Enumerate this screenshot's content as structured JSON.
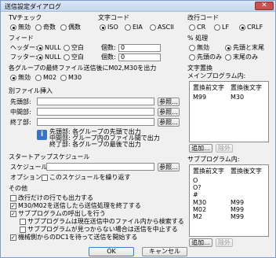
{
  "window": {
    "title": "送信設定ダイアログ",
    "close_symbol": "✕"
  },
  "tv_check": {
    "label": "TVチェック",
    "options": [
      "無効",
      "奇数",
      "偶数"
    ],
    "selected": 0
  },
  "char_code": {
    "label": "文字コード",
    "options": [
      "ISO",
      "EIA",
      "ASCII"
    ],
    "selected": 0
  },
  "newline_code": {
    "label": "改行コード",
    "options": [
      "CR",
      "LF",
      "CRLF"
    ],
    "selected": 2
  },
  "feed": {
    "label": "フィード",
    "header_label": "ヘッダー:",
    "footer_label": "フッター:",
    "options": [
      "NULL",
      "空白"
    ],
    "header_selected": 0,
    "footer_selected": 0,
    "count_label": "個数:",
    "header_count": "0",
    "footer_count": "0"
  },
  "percent_process": {
    "label": "% 処理",
    "options": [
      "無効",
      "先頭と末尾",
      "先頭のみ",
      "末尾のみ"
    ],
    "selected": 1
  },
  "group_last": {
    "label": "各グループの最終ファイル送信後にM02,M30を出力",
    "options": [
      "無効",
      "M02",
      "M30"
    ],
    "selected": 0
  },
  "file_insert": {
    "label": "別ファイル挿入",
    "head_label": "先頭部:",
    "middle_label": "中間部:",
    "end_label": "終了部:",
    "browse_label": "参照...",
    "info_lines": [
      "先頭部: 各グループの先頭で出力",
      "中間部: グループ内のファイル間で出力",
      "終了部: 各グループの最後で出力"
    ]
  },
  "startup": {
    "label": "スタートアップスケジュール",
    "schedule_label": "スケジュール:",
    "browse_label": "参照...",
    "option_label": "オプション:",
    "repeat_label": "このスケジュールを繰り返す",
    "repeat_checked": false
  },
  "others": {
    "label": "その他",
    "items": [
      {
        "text": "改行だけの行でも出力する",
        "checked": false,
        "indent": 0
      },
      {
        "text": "M30/M02を送信したら送信処理を終了する",
        "checked": true,
        "indent": 0
      },
      {
        "text": "サブプログラムの呼出しを行う",
        "checked": true,
        "indent": 0
      },
      {
        "text": "サブプログラムは現在送信中のファイル内から検索する",
        "checked": false,
        "indent": 1
      },
      {
        "text": "サブプログラムが見つからない場合は送信を中止する",
        "checked": false,
        "indent": 1
      },
      {
        "text": "機械側からのDC1を待って送信を開始する",
        "checked": true,
        "indent": 0
      }
    ]
  },
  "replace": {
    "label": "文字置換",
    "main_label": "メインプログラム内:",
    "col_before": "置換前文字",
    "col_after": "置換後文字",
    "main_rows": [
      {
        "before": "M99",
        "after": "M30"
      }
    ],
    "add_label": "追加...",
    "remove_label": "除外",
    "sub_label": "サブプログラム内:",
    "sub_rows": [
      {
        "before": "O",
        "after": ""
      },
      {
        "before": "O?",
        "after": ""
      },
      {
        "before": "#",
        "after": ""
      },
      {
        "before": "M30",
        "after": "M99"
      },
      {
        "before": "M02",
        "after": "M99"
      },
      {
        "before": "M2",
        "after": "M99"
      }
    ]
  },
  "footer": {
    "ok_label": "OK",
    "cancel_label": "キャンセル"
  }
}
